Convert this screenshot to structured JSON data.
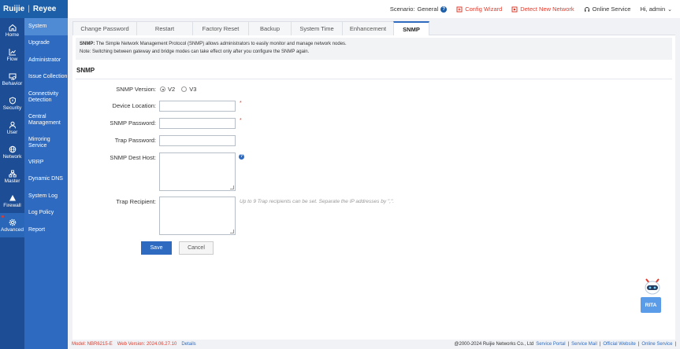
{
  "brand": {
    "logo_left": "Ruijie",
    "logo_right": "Reyee"
  },
  "header": {
    "scenario_label": "Scenario:",
    "scenario_value": "General",
    "config_wizard": "Config Wizard",
    "detect_network": "Detect New Network",
    "online_service": "Online Service",
    "user_greeting": "Hi, admin"
  },
  "nav_main": [
    {
      "label": "Home",
      "icon": "home-icon"
    },
    {
      "label": "Flow",
      "icon": "chart-line-icon"
    },
    {
      "label": "Behavior",
      "icon": "behavior-icon"
    },
    {
      "label": "Security",
      "icon": "shield-icon"
    },
    {
      "label": "User",
      "icon": "user-icon"
    },
    {
      "label": "Network",
      "icon": "globe-icon"
    },
    {
      "label": "Master",
      "icon": "master-icon"
    },
    {
      "label": "Firewall",
      "icon": "firewall-icon"
    },
    {
      "label": "Advanced",
      "icon": "gear-icon"
    }
  ],
  "nav_sub": [
    {
      "label": "System"
    },
    {
      "label": "Upgrade"
    },
    {
      "label": "Administrator"
    },
    {
      "label": "Issue Collection"
    },
    {
      "label": "Connectivity Detection"
    },
    {
      "label": "Central Management"
    },
    {
      "label": "Mirroring Service"
    },
    {
      "label": "VRRP"
    },
    {
      "label": "Dynamic DNS"
    },
    {
      "label": "System Log"
    },
    {
      "label": "Log Policy"
    },
    {
      "label": "Report"
    }
  ],
  "tabs": [
    {
      "label": "Change Password"
    },
    {
      "label": "Restart"
    },
    {
      "label": "Factory Reset"
    },
    {
      "label": "Backup"
    },
    {
      "label": "System Time"
    },
    {
      "label": "Enhancement"
    },
    {
      "label": "SNMP"
    }
  ],
  "note": {
    "bold": "SNMP:",
    "line1": " The Simple Network Management Protocol (SNMP) allows administrators to easily monitor and manage network nodes.",
    "line2": "Note: Switching between gateway and bridge modes can take effect only after you configure the SNMP again."
  },
  "section_title": "SNMP",
  "form": {
    "version_label": "SNMP Version:",
    "version_v2": "V2",
    "version_v3": "V3",
    "version_selected": "V2",
    "location_label": "Device Location:",
    "location_value": "",
    "password_label": "SNMP Password:",
    "password_value": "",
    "trap_password_label": "Trap Password:",
    "trap_password_value": "",
    "dest_host_label": "SNMP Dest Host:",
    "dest_host_value": "",
    "trap_recipient_label": "Trap Recipient:",
    "trap_recipient_value": "",
    "trap_recipient_hint": "Up to 9 Trap recipients can be set. Separate the IP addresses by \",\".",
    "required_mark": "*",
    "info_glyph": "?"
  },
  "buttons": {
    "save": "Save",
    "cancel": "Cancel"
  },
  "assistant": {
    "label": "RITA"
  },
  "footer": {
    "model": "Model:  NBR6215-E",
    "web_version": "Web Version:  2024.06.27.10",
    "details": "Details",
    "copyright": "@2000-2024 Ruijie Networks Co., Ltd",
    "links": [
      "Service Portal",
      "Service Mail",
      "Official Website",
      "Online Service"
    ],
    "sep": "|"
  },
  "colors": {
    "primary": "#2e6bc0",
    "sidebar": "#1d4e95",
    "accent_red": "#e03b2c"
  }
}
